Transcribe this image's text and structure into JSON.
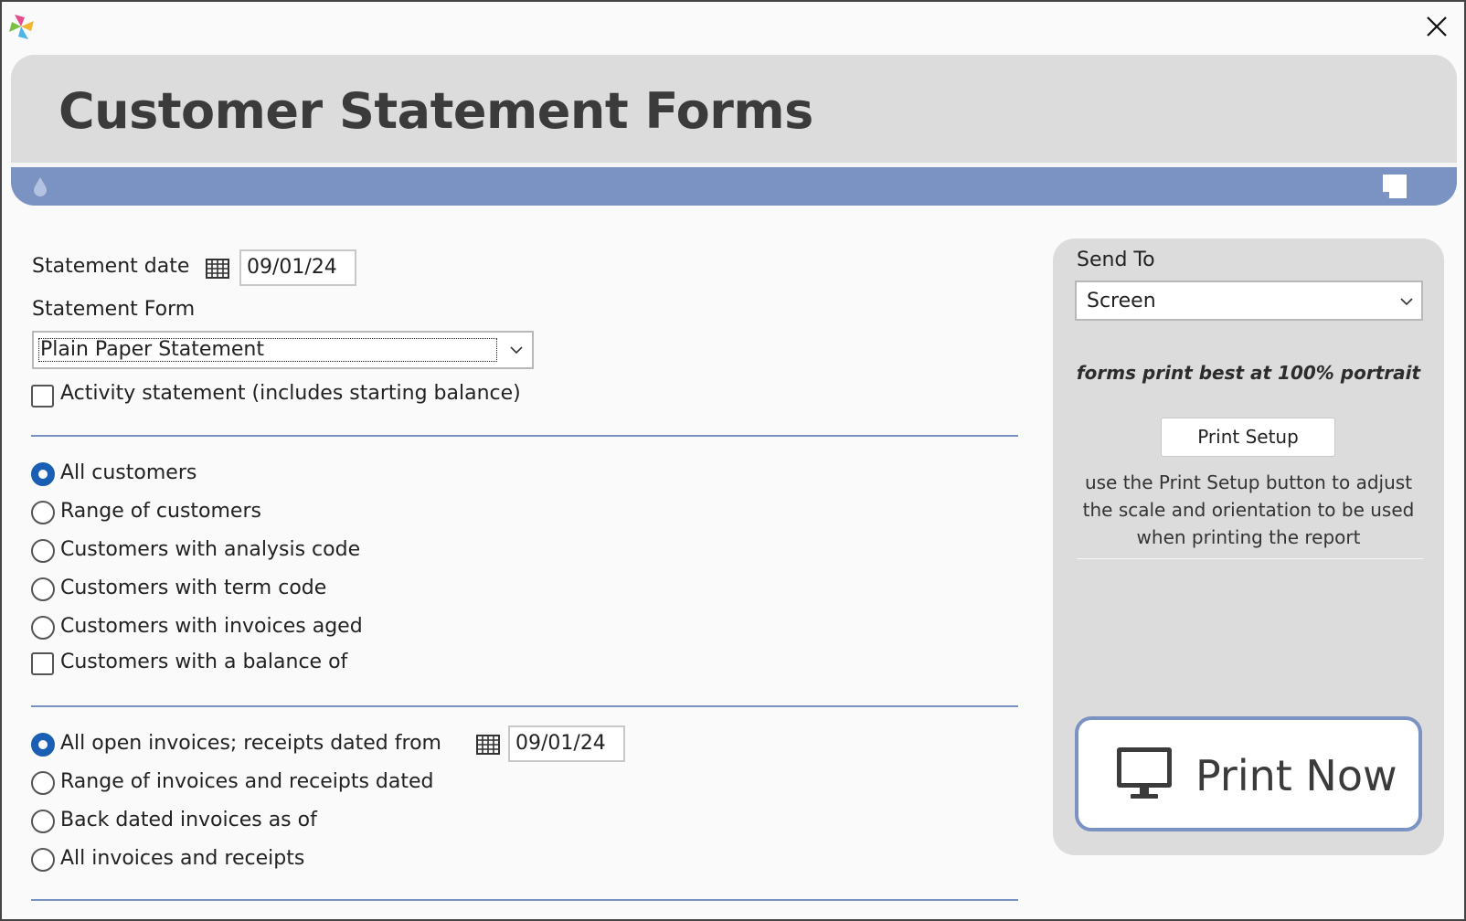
{
  "window": {
    "logo_icon": "app-pinwheel-icon",
    "close_icon": "close-icon"
  },
  "header": {
    "title": "Customer Statement Forms",
    "band_color": "#7b93c2",
    "left_icon": "droplet-icon",
    "right_icon": "page-icon"
  },
  "statement": {
    "date_label": "Statement date",
    "date_value": "09/01/24",
    "form_label": "Statement Form",
    "form_value": "Plain Paper Statement",
    "activity_label": "Activity statement (includes starting balance)",
    "activity_checked": false
  },
  "customers": {
    "selected_index": 0,
    "options": [
      "All customers",
      "Range of customers",
      "Customers with analysis code",
      "Customers with term code",
      "Customers with invoices aged"
    ],
    "balance_label": "Customers with a balance of",
    "balance_checked": false
  },
  "invoices": {
    "selected_index": 0,
    "options": [
      "All open invoices; receipts dated from",
      "Range of invoices and receipts dated",
      "Back dated invoices as of",
      "All invoices and receipts"
    ],
    "from_date": "09/01/24"
  },
  "send_to": {
    "label": "Send To",
    "value": "Screen",
    "hint": "forms print best at 100% portrait",
    "print_setup_label": "Print Setup",
    "setup_help_line1": "use the Print Setup button to adjust",
    "setup_help_line2": "the scale and orientation to be used",
    "setup_help_line3": "when printing the report",
    "print_now_label": "Print Now",
    "print_now_icon": "monitor-icon"
  },
  "colors": {
    "accent": "#1a5fb4",
    "rule": "#7891c0",
    "panel": "#dcdcdc"
  }
}
